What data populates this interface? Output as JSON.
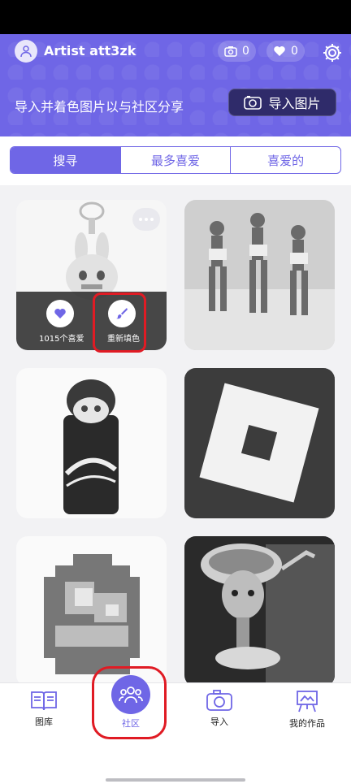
{
  "header": {
    "username": "Artist att3zk",
    "photo_count": "0",
    "like_count": "0",
    "subtitle": "导入并着色图片以与社区分享",
    "import_label": "导入图片"
  },
  "tabs": [
    {
      "label": "搜寻",
      "active": true
    },
    {
      "label": "最多喜爱",
      "active": false
    },
    {
      "label": "喜爱的",
      "active": false
    }
  ],
  "cards": [
    {
      "subject": "bunny keychain figure",
      "likes_label": "1015个喜爱",
      "recolor_label": "重新填色"
    },
    {
      "subject": "three dancing women"
    },
    {
      "subject": "Coca-Cola can with bunny figure"
    },
    {
      "subject": "Roblox logo"
    },
    {
      "subject": "pixel orb"
    },
    {
      "subject": "ballerina with teacup head"
    }
  ],
  "nav": [
    {
      "label": "图库",
      "icon": "book-icon"
    },
    {
      "label": "社区",
      "icon": "people-icon",
      "active": true
    },
    {
      "label": "导入",
      "icon": "camera-icon"
    },
    {
      "label": "我的作品",
      "icon": "easel-icon"
    }
  ],
  "colors": {
    "accent": "#6f66e6",
    "highlight": "#e01b24",
    "dark_button": "#2f2b6a"
  }
}
